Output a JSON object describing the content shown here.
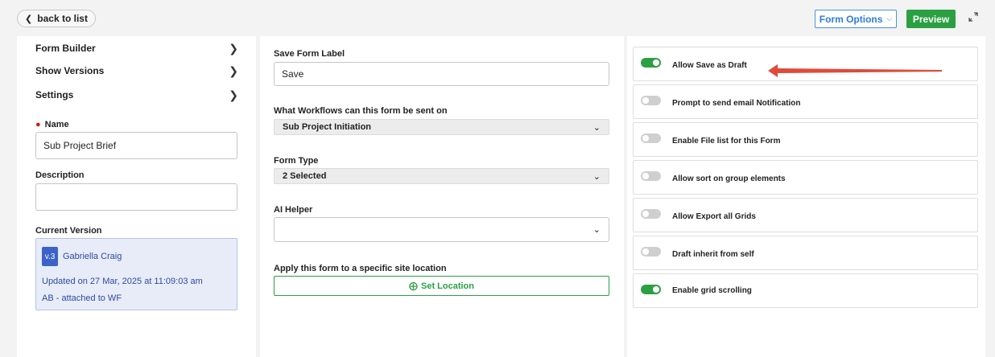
{
  "header": {
    "back_label": "back to list",
    "form_options_label": "Form Options",
    "preview_label": "Preview"
  },
  "sidebar": {
    "items": [
      {
        "label": "Form Builder"
      },
      {
        "label": "Show Versions"
      },
      {
        "label": "Settings"
      }
    ],
    "name_label": "Name",
    "name_value": "Sub Project Brief",
    "description_label": "Description",
    "description_value": "",
    "current_version_label": "Current Version",
    "version": {
      "badge": "v.3",
      "author": "Gabriella Craig",
      "updated": "Updated on 27 Mar, 2025 at 11:09:03 am",
      "note": "AB - attached to WF"
    }
  },
  "main": {
    "save_label_title": "Save Form Label",
    "save_label_value": "Save",
    "workflows_title": "What Workflows can this form be sent on",
    "workflows_value": "Sub Project Initiation",
    "form_type_title": "Form Type",
    "form_type_value": "2 Selected",
    "ai_helper_title": "AI Helper",
    "ai_helper_value": "",
    "location_title": "Apply this form to a specific site location",
    "set_location_label": "Set Location"
  },
  "settings": {
    "toggles": [
      {
        "label": "Allow Save as Draft",
        "on": true
      },
      {
        "label": "Prompt to send email Notification",
        "on": false
      },
      {
        "label": "Enable File list for this Form",
        "on": false
      },
      {
        "label": "Allow sort on group elements",
        "on": false
      },
      {
        "label": "Allow Export all Grids",
        "on": false
      },
      {
        "label": "Draft inherit from self",
        "on": false
      },
      {
        "label": "Enable grid scrolling",
        "on": true
      }
    ]
  },
  "colors": {
    "accent_green": "#2aa043",
    "accent_blue": "#2d7ce0",
    "annotation_red": "#e04a3a",
    "version_card_bg": "#e8ecf8"
  }
}
